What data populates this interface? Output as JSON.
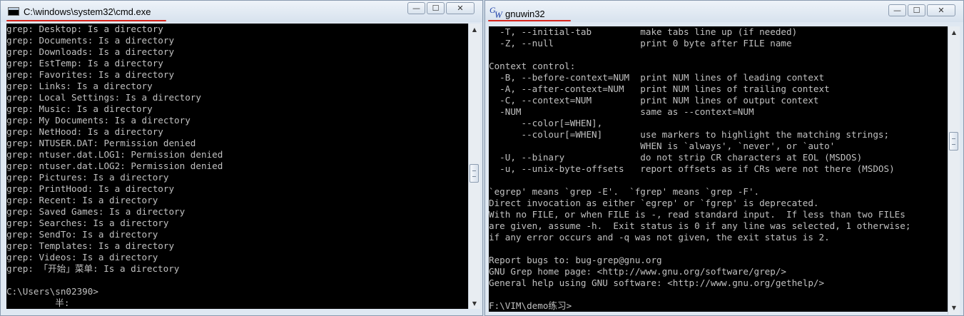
{
  "cmd_window": {
    "title": "C:\\windows\\system32\\cmd.exe",
    "controls": {
      "minimize": "—",
      "maximize": "☐",
      "close": "✕"
    },
    "lines": [
      "grep: Desktop: Is a directory",
      "grep: Documents: Is a directory",
      "grep: Downloads: Is a directory",
      "grep: EstTemp: Is a directory",
      "grep: Favorites: Is a directory",
      "grep: Links: Is a directory",
      "grep: Local Settings: Is a directory",
      "grep: Music: Is a directory",
      "grep: My Documents: Is a directory",
      "grep: NetHood: Is a directory",
      "grep: NTUSER.DAT: Permission denied",
      "grep: ntuser.dat.LOG1: Permission denied",
      "grep: ntuser.dat.LOG2: Permission denied",
      "grep: Pictures: Is a directory",
      "grep: PrintHood: Is a directory",
      "grep: Recent: Is a directory",
      "grep: Saved Games: Is a directory",
      "grep: Searches: Is a directory",
      "grep: SendTo: Is a directory",
      "grep: Templates: Is a directory",
      "grep: Videos: Is a directory",
      "grep: 「开始」菜单: Is a directory",
      "",
      "C:\\Users\\sn02390>",
      "         半:"
    ]
  },
  "gnu_window": {
    "title": "gnuwin32",
    "icon_text": {
      "g": "G",
      "w": "W"
    },
    "controls": {
      "minimize": "—",
      "maximize": "☐",
      "close": "✕"
    },
    "lines": [
      "  -T, --initial-tab         make tabs line up (if needed)",
      "  -Z, --null                print 0 byte after FILE name",
      "",
      "Context control:",
      "  -B, --before-context=NUM  print NUM lines of leading context",
      "  -A, --after-context=NUM   print NUM lines of trailing context",
      "  -C, --context=NUM         print NUM lines of output context",
      "  -NUM                      same as --context=NUM",
      "      --color[=WHEN],",
      "      --colour[=WHEN]       use markers to highlight the matching strings;",
      "                            WHEN is `always', `never', or `auto'",
      "  -U, --binary              do not strip CR characters at EOL (MSDOS)",
      "  -u, --unix-byte-offsets   report offsets as if CRs were not there (MSDOS)",
      "",
      "`egrep' means `grep -E'.  `fgrep' means `grep -F'.",
      "Direct invocation as either `egrep' or `fgrep' is deprecated.",
      "With no FILE, or when FILE is -, read standard input.  If less than two FILEs",
      "are given, assume -h.  Exit status is 0 if any line was selected, 1 otherwise;",
      "if any error occurs and -q was not given, the exit status is 2.",
      "",
      "Report bugs to: bug-grep@gnu.org",
      "GNU Grep home page: <http://www.gnu.org/software/grep/>",
      "General help using GNU software: <http://www.gnu.org/gethelp/>",
      "",
      "F:\\VIM\\demo练习>"
    ]
  },
  "colors": {
    "console_bg": "#000000",
    "console_fg": "#c0c0c0",
    "annotation_underline": "#d9251d"
  }
}
